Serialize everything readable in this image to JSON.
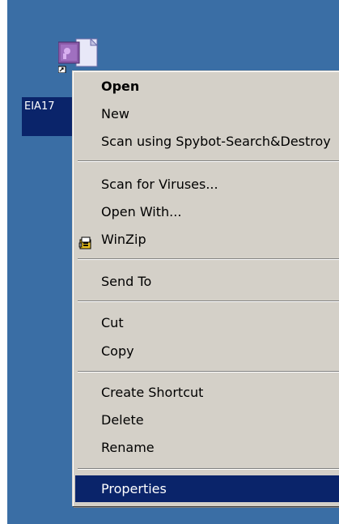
{
  "desktop": {
    "background_color": "#3a6ea5",
    "icon": {
      "label": "EIA17",
      "icon_name": "shortcut-document-icon"
    }
  },
  "context_menu": {
    "items": [
      {
        "label": "Open",
        "bold": true
      },
      {
        "label": "New"
      },
      {
        "label": "Scan using Spybot-Search&Destroy"
      },
      {
        "separator": true
      },
      {
        "label": "Scan for Viruses..."
      },
      {
        "label": "Open With..."
      },
      {
        "label": "WinZip",
        "icon": "winzip-icon"
      },
      {
        "separator": true
      },
      {
        "label": "Send To"
      },
      {
        "separator": true
      },
      {
        "label": "Cut"
      },
      {
        "label": "Copy"
      },
      {
        "separator": true
      },
      {
        "label": "Create Shortcut"
      },
      {
        "label": "Delete"
      },
      {
        "label": "Rename"
      },
      {
        "separator": true
      },
      {
        "label": "Properties",
        "selected": true
      }
    ],
    "selection_color": "#0a246a"
  }
}
